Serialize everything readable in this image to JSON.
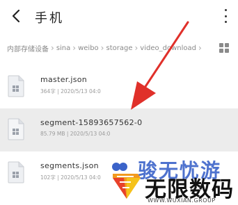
{
  "header": {
    "title": "手机",
    "back_icon": "back-chevron-icon",
    "more_icon": "more-vertical-icon"
  },
  "breadcrumb": {
    "items": [
      "内部存储设备",
      "sina",
      "weibo",
      "storage",
      "video_download"
    ],
    "view_toggle_icon": "grid-view-icon"
  },
  "files": [
    {
      "name": "master.json",
      "meta": "364字 | 2020/5/13 04:0",
      "selected": false
    },
    {
      "name": "segment-15893657562-0",
      "meta": "85.79 MB | 2020/5/13 04:0",
      "selected": true
    },
    {
      "name": "segments.json",
      "meta": "102字 | 2020/5/13 04:0",
      "selected": false
    }
  ],
  "watermark": {
    "line1": "骏无忧游",
    "line2": "无限数码",
    "line3": "WWW.WUXIAN.GROUP"
  },
  "colors": {
    "arrow": "#e0302a",
    "selected_row": "#ececec",
    "watermark_blue": "#3b63c9"
  }
}
